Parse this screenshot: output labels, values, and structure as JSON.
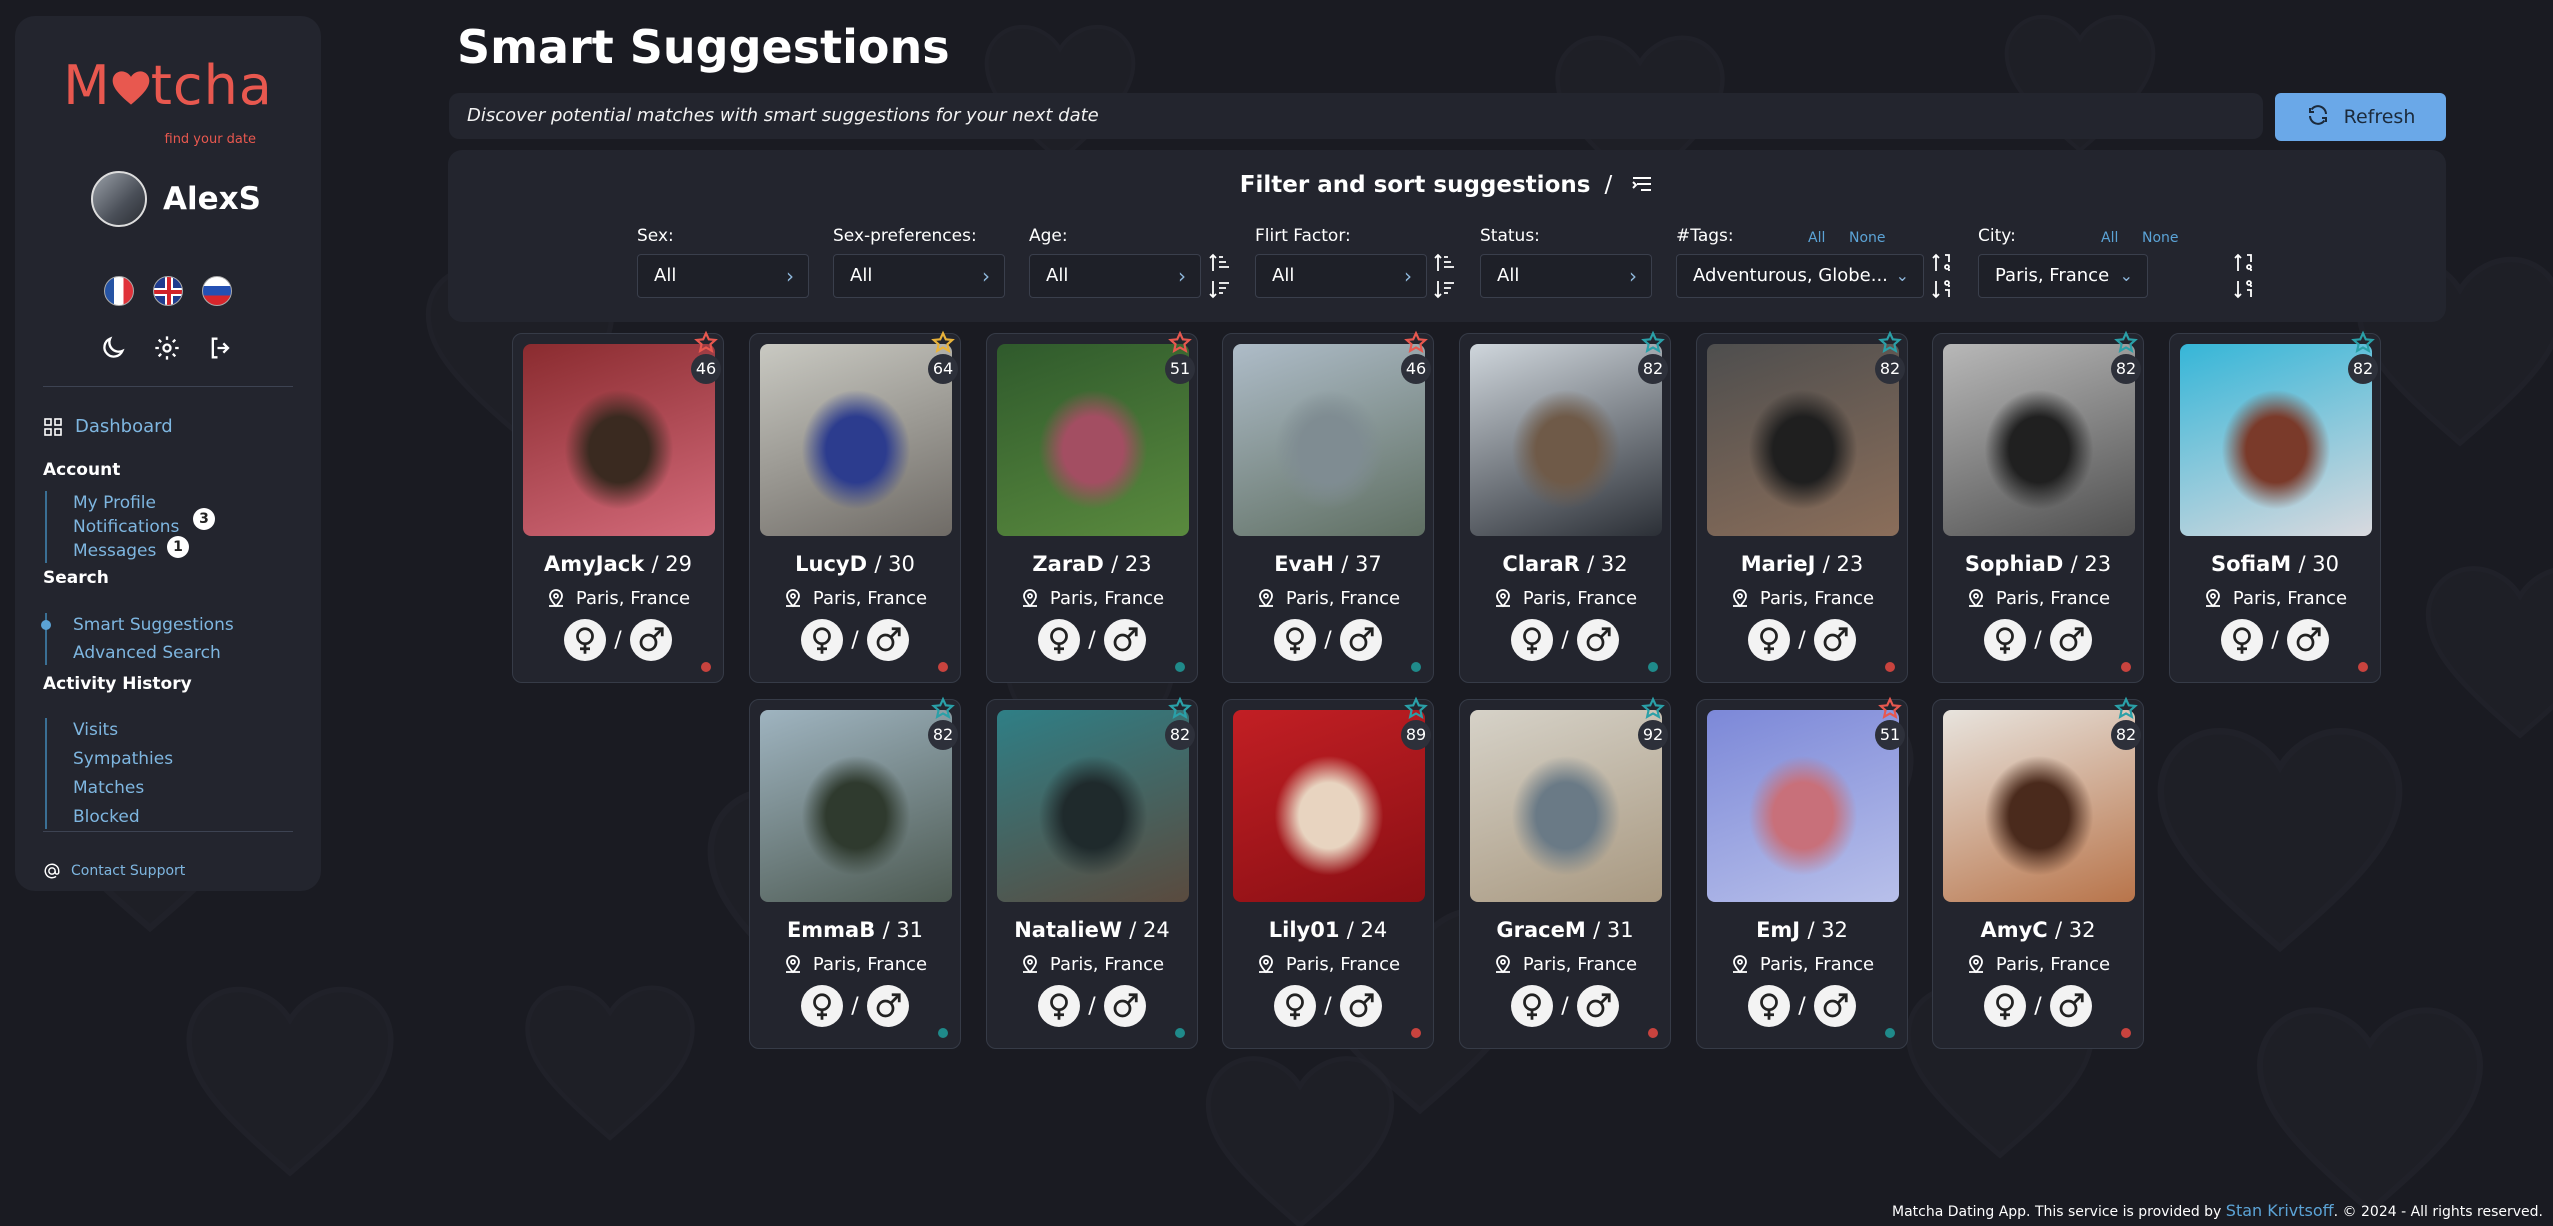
{
  "app": {
    "logo_text_pre": "M",
    "logo_text_post": "tcha",
    "tagline": "find your date"
  },
  "user": {
    "name": "AlexS"
  },
  "languages": [
    "fr-flag",
    "uk-flag",
    "ru-flag"
  ],
  "sidebar": {
    "dashboard": "Dashboard",
    "account_title": "Account",
    "account_items": [
      {
        "label": "My Profile"
      },
      {
        "label": "Notifications",
        "badge": "3"
      },
      {
        "label": "Messages",
        "badge": "1"
      }
    ],
    "search_title": "Search",
    "search_items": [
      {
        "label": "Smart Suggestions"
      },
      {
        "label": "Advanced Search"
      }
    ],
    "activity_title": "Activity History",
    "activity_items": [
      {
        "label": "Visits"
      },
      {
        "label": "Sympathies"
      },
      {
        "label": "Matches"
      },
      {
        "label": "Blocked"
      }
    ],
    "contact": "Contact Support"
  },
  "page": {
    "title": "Smart Suggestions",
    "banner": "Discover potential matches with smart suggestions for your next date",
    "refresh_label": "Refresh"
  },
  "filters": {
    "title": "Filter and sort suggestions",
    "sex": {
      "label": "Sex:",
      "value": "All"
    },
    "sex_pref": {
      "label": "Sex-preferences:",
      "value": "All"
    },
    "age": {
      "label": "Age:",
      "value": "All"
    },
    "flirt": {
      "label": "Flirt Factor:",
      "value": "All"
    },
    "status": {
      "label": "Status:",
      "value": "All"
    },
    "tags": {
      "label": "#Tags:",
      "value": "Adventurous, Globe...",
      "all": "All",
      "none": "None"
    },
    "city": {
      "label": "City:",
      "value": "Paris, France",
      "all": "All",
      "none": "None"
    }
  },
  "cards": [
    {
      "name": "AmyJack",
      "age": "/ 29",
      "city": "Paris, France",
      "score": "46",
      "star": "#e8584f",
      "status": "#c8433e",
      "photo": [
        "#8a2b2f",
        "#d36a7a",
        "#3a2a20"
      ]
    },
    {
      "name": "LucyD",
      "age": "/ 30",
      "city": "Paris, France",
      "score": "64",
      "star": "#e8b23a",
      "status": "#c8433e",
      "photo": [
        "#c9c9c2",
        "#6f6b66",
        "#2c3c8e"
      ]
    },
    {
      "name": "ZaraD",
      "age": "/ 23",
      "city": "Paris, France",
      "score": "51",
      "star": "#e8584f",
      "status": "#1f8a8a",
      "photo": [
        "#2f5a2c",
        "#5a8a3e",
        "#a34e62"
      ]
    },
    {
      "name": "EvaH",
      "age": "/ 37",
      "city": "Paris, France",
      "score": "46",
      "star": "#e8584f",
      "status": "#1f8a8a",
      "photo": [
        "#aebcc8",
        "#5f6f62",
        "#7f8c92"
      ]
    },
    {
      "name": "ClaraR",
      "age": "/ 32",
      "city": "Paris, France",
      "score": "82",
      "star": "#2aa0a8",
      "status": "#1f8a8a",
      "photo": [
        "#cfd6dc",
        "#2b2f36",
        "#6f5a48"
      ]
    },
    {
      "name": "MarieJ",
      "age": "/ 23",
      "city": "Paris, France",
      "score": "82",
      "star": "#2aa0a8",
      "status": "#c8433e",
      "photo": [
        "#4e4e4e",
        "#8b6e5a",
        "#1f1f1f"
      ]
    },
    {
      "name": "SophiaD",
      "age": "/ 23",
      "city": "Paris, France",
      "score": "82",
      "star": "#2aa0a8",
      "status": "#c8433e",
      "photo": [
        "#b8b8b8",
        "#505050",
        "#202020"
      ]
    },
    {
      "name": "SofiaM",
      "age": "/ 30",
      "city": "Paris, France",
      "score": "82",
      "star": "#2aa0a8",
      "status": "#c8433e",
      "photo": [
        "#35b6d8",
        "#d9d9de",
        "#7a3a2a"
      ]
    },
    {
      "name": "EmmaB",
      "age": "/ 31",
      "city": "Paris, France",
      "score": "82",
      "star": "#2aa0a8",
      "status": "#1f8a8a",
      "photo": [
        "#9fb4c0",
        "#4d5a52",
        "#2f3a2e"
      ]
    },
    {
      "name": "NatalieW",
      "age": "/ 24",
      "city": "Paris, France",
      "score": "82",
      "star": "#2aa0a8",
      "status": "#1f8a8a",
      "photo": [
        "#2f7f86",
        "#5a4a3e",
        "#1f2a2c"
      ]
    },
    {
      "name": "Lily01",
      "age": "/ 24",
      "city": "Paris, France",
      "score": "89",
      "star": "#2aa0a8",
      "status": "#c8433e",
      "photo": [
        "#c21f24",
        "#8a0f14",
        "#e8d4c0"
      ]
    },
    {
      "name": "GraceM",
      "age": "/ 31",
      "city": "Paris, France",
      "score": "92",
      "star": "#2aa0a8",
      "status": "#c8433e",
      "photo": [
        "#d6d2c8",
        "#a89880",
        "#6a7a86"
      ]
    },
    {
      "name": "EmJ",
      "age": "/ 32",
      "city": "Paris, France",
      "score": "51",
      "star": "#e8584f",
      "status": "#1f8a8a",
      "photo": [
        "#7c88d8",
        "#b8c0ea",
        "#c8707a"
      ]
    },
    {
      "name": "AmyC",
      "age": "/ 32",
      "city": "Paris, France",
      "score": "82",
      "star": "#2aa0a8",
      "status": "#c8433e",
      "photo": [
        "#e8e4de",
        "#b8744a",
        "#4a2a1c"
      ]
    }
  ],
  "footer": {
    "pre": "Matcha Dating App. This service is provided by ",
    "author": "Stan Krivtsoff",
    "post": ". © 2024 - All rights reserved."
  }
}
